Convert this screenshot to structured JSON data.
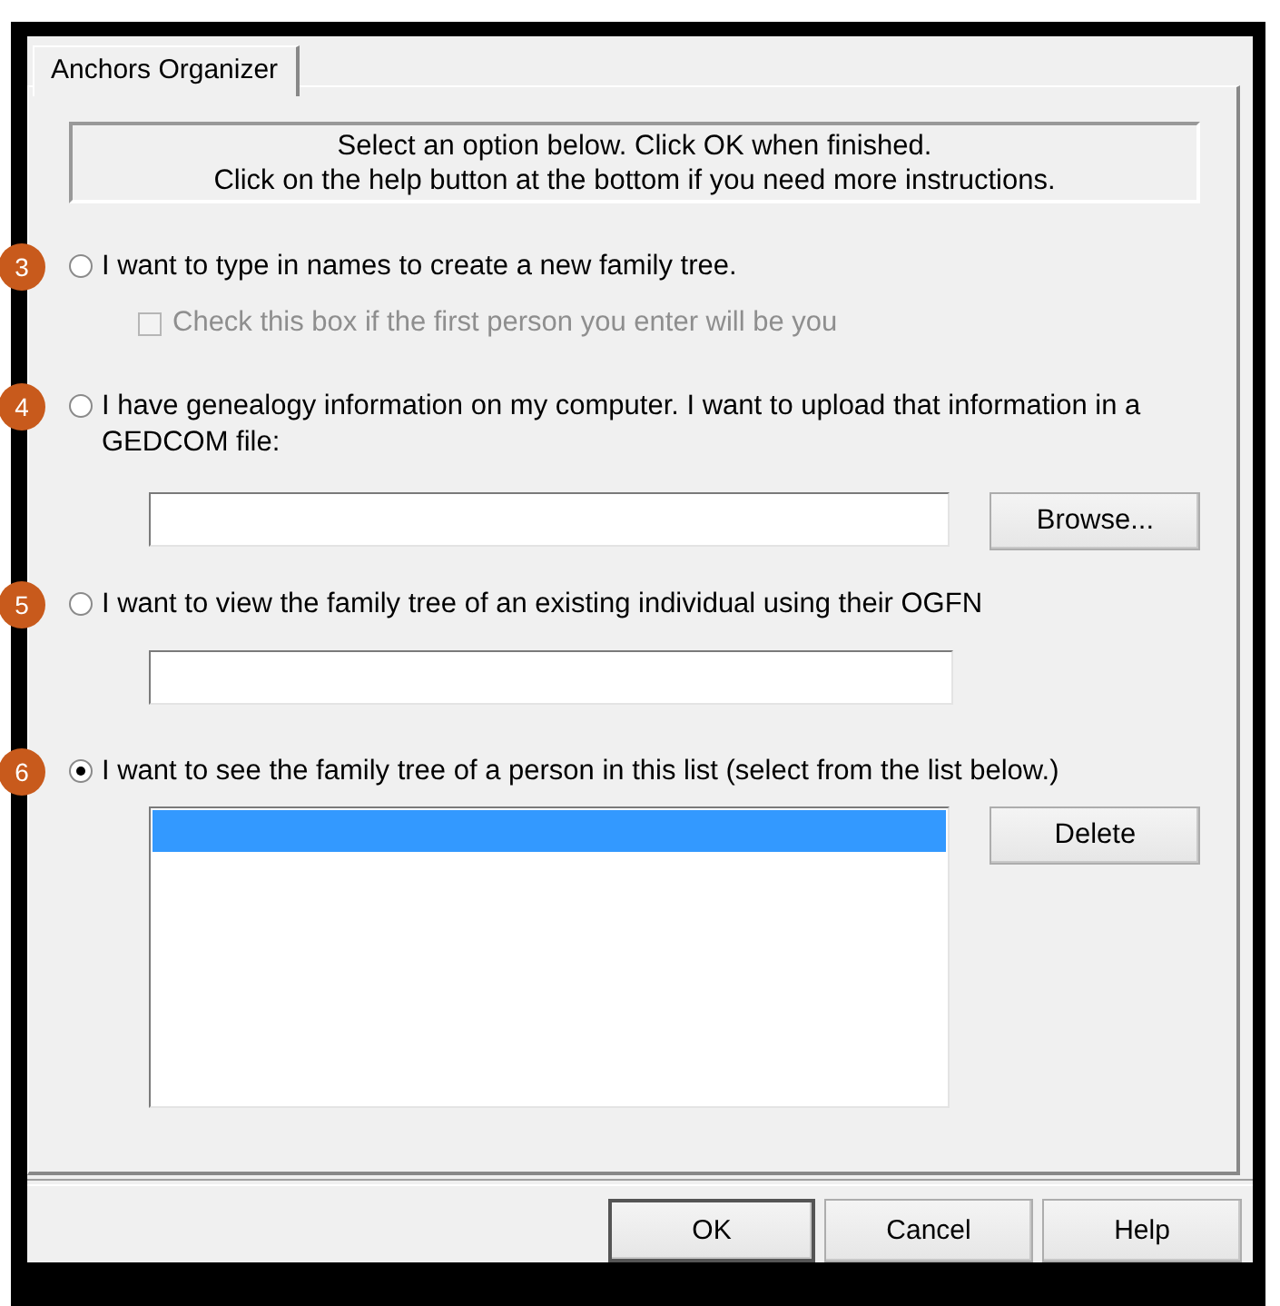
{
  "tabs": [
    {
      "label": "Anchors Organizer",
      "selected": true
    }
  ],
  "instructions": [
    "Select an option below. Click OK when finished.",
    "Click on the help button at the bottom if you need more instructions."
  ],
  "options": [
    {
      "marker": "3",
      "kind": "checkbox",
      "label": "I want to type in names to create a new family tree.",
      "selected": false,
      "checkbox": {
        "label": "Check this box if the first person you enter will be you",
        "checked": false,
        "disabled": true
      }
    },
    {
      "marker": "4",
      "kind": "file",
      "label": "I have genealogy information on my computer. I want to upload that information in a GEDCOM file:",
      "selected": false,
      "button": "Browse..."
    },
    {
      "marker": "5",
      "kind": "text",
      "label": "I want to view the family tree of an existing individual using their OGFN",
      "selected": false
    },
    {
      "marker": "6",
      "kind": "list",
      "label": "I want to see the family tree of a person in this list (select from the list below.)",
      "selected": true,
      "rows": [
        {
          "selected": true
        }
      ],
      "button": "Delete"
    }
  ],
  "buttons": [
    {
      "label": "OK",
      "default": true
    },
    {
      "label": "Cancel",
      "default": false
    },
    {
      "label": "Help",
      "default": false
    }
  ]
}
